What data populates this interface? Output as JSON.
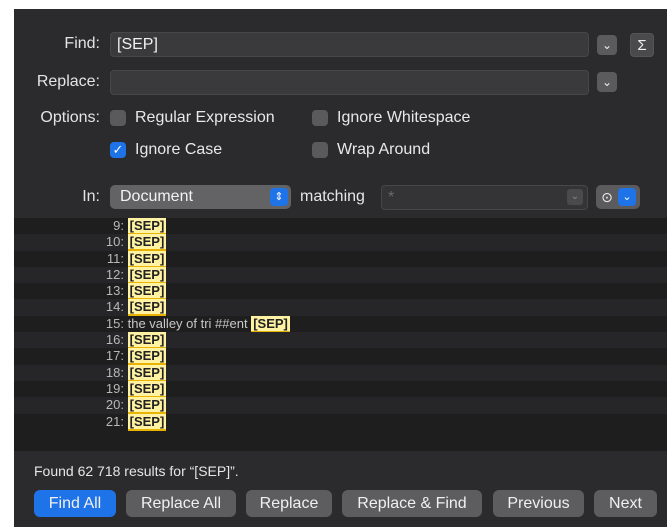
{
  "find": {
    "label": "Find:",
    "value": "[SEP]",
    "dropdown_icon": "chevron-down-icon",
    "sigma_label": "Σ"
  },
  "replace": {
    "label": "Replace:",
    "value": "",
    "dropdown_icon": "chevron-down-icon"
  },
  "options": {
    "label": "Options:",
    "regular_expression": {
      "label": "Regular Expression",
      "checked": false
    },
    "ignore_whitespace": {
      "label": "Ignore Whitespace",
      "checked": false
    },
    "ignore_case": {
      "label": "Ignore Case",
      "checked": true
    },
    "wrap_around": {
      "label": "Wrap Around",
      "checked": false
    }
  },
  "scope": {
    "label": "In:",
    "selected": "Document",
    "matching_label": "matching",
    "matching_value": "*"
  },
  "results": [
    {
      "line": "9:",
      "prefix": "",
      "hit": "[SEP]"
    },
    {
      "line": "10:",
      "prefix": "",
      "hit": "[SEP]"
    },
    {
      "line": "11:",
      "prefix": "",
      "hit": "[SEP]"
    },
    {
      "line": "12:",
      "prefix": "",
      "hit": "[SEP]"
    },
    {
      "line": "13:",
      "prefix": "",
      "hit": "[SEP]"
    },
    {
      "line": "14:",
      "prefix": "",
      "hit": "[SEP]"
    },
    {
      "line": "15:",
      "prefix": "the valley of tri ##ent ",
      "hit": "[SEP]"
    },
    {
      "line": "16:",
      "prefix": "",
      "hit": "[SEP]"
    },
    {
      "line": "17:",
      "prefix": "",
      "hit": "[SEP]"
    },
    {
      "line": "18:",
      "prefix": "",
      "hit": "[SEP]"
    },
    {
      "line": "19:",
      "prefix": "",
      "hit": "[SEP]"
    },
    {
      "line": "20:",
      "prefix": "",
      "hit": "[SEP]"
    },
    {
      "line": "21:",
      "prefix": "",
      "hit": "[SEP]"
    }
  ],
  "status": "Found 62 718 results for “[SEP]”.",
  "buttons": {
    "find_all": "Find All",
    "replace_all": "Replace All",
    "replace": "Replace",
    "replace_and_find": "Replace & Find",
    "previous": "Previous",
    "next": "Next"
  },
  "colors": {
    "accent": "#1f73e8",
    "background": "#2b2b2d",
    "highlight": "#fff3a3"
  }
}
